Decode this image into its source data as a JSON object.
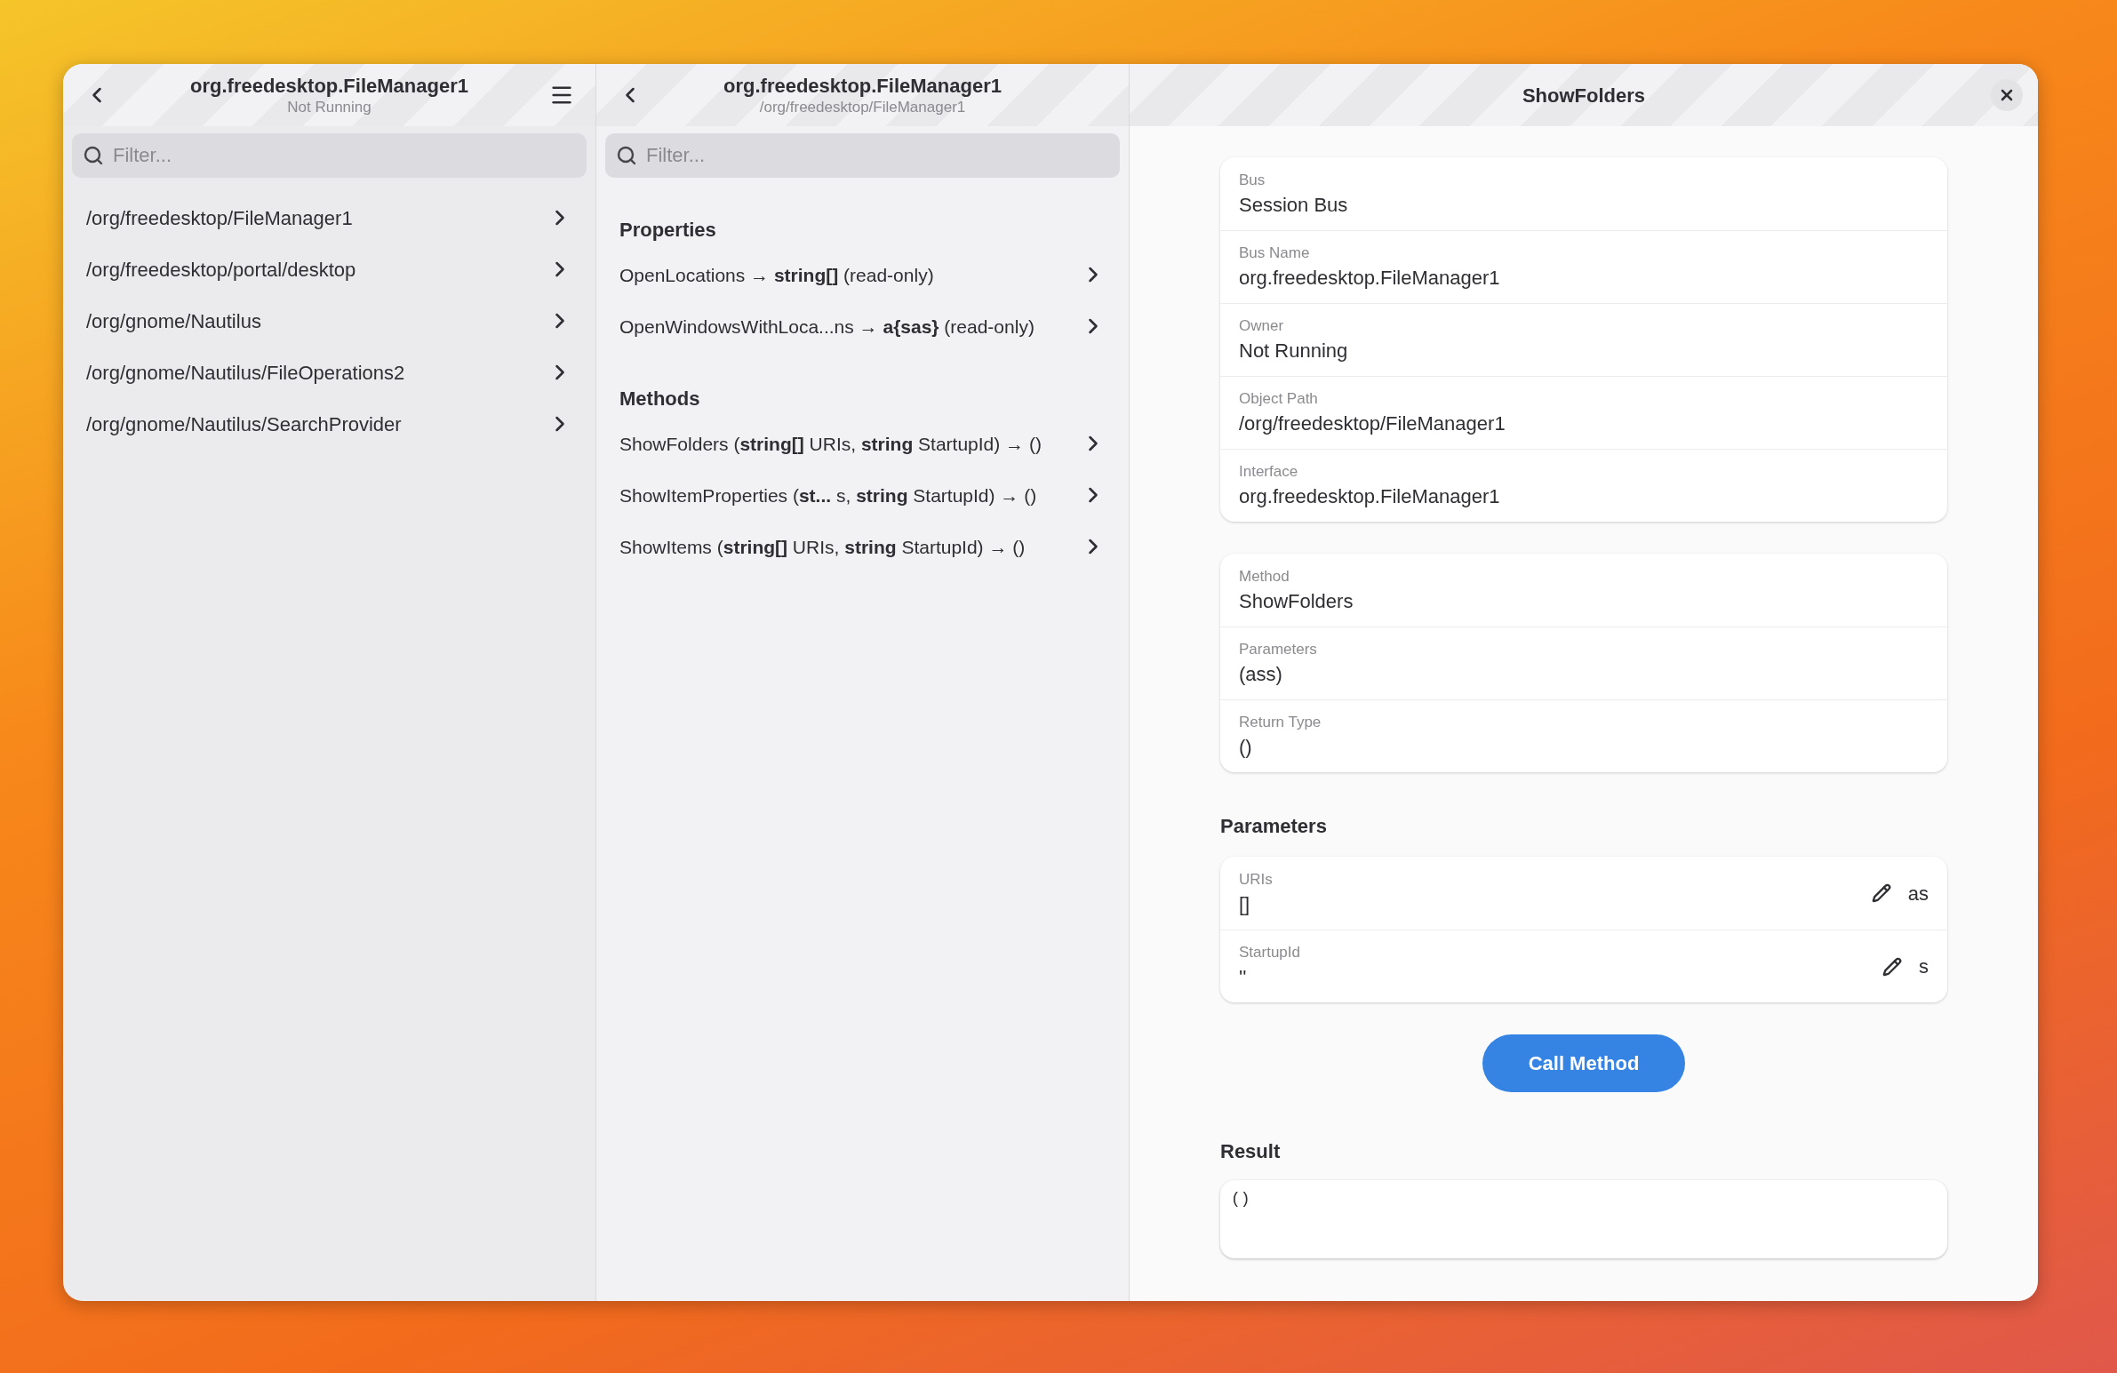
{
  "objects_pane": {
    "title": "org.freedesktop.FileManager1",
    "subtitle": "Not Running",
    "filter": {
      "placeholder": "Filter..."
    },
    "items": [
      {
        "label": "/org/freedesktop/FileManager1"
      },
      {
        "label": "/org/freedesktop/portal/desktop"
      },
      {
        "label": "/org/gnome/Nautilus"
      },
      {
        "label": "/org/gnome/Nautilus/FileOperations2"
      },
      {
        "label": "/org/gnome/Nautilus/SearchProvider"
      }
    ]
  },
  "interface_pane": {
    "title": "org.freedesktop.FileManager1",
    "subtitle": "/org/freedesktop/FileManager1",
    "filter": {
      "placeholder": "Filter..."
    },
    "sections": [
      {
        "heading": "Properties",
        "items": [
          {
            "label": "OpenLocations → **string[]** (read-only)"
          },
          {
            "label": "OpenWindowsWithLoca...ns → **a{sas}** (read-only)"
          }
        ]
      },
      {
        "heading": "Methods",
        "items": [
          {
            "label": "ShowFolders (**string[]** URIs, **string** StartupId) → ()"
          },
          {
            "label": "ShowItemProperties (**st...** s, **string** StartupId) → ()"
          },
          {
            "label": "ShowItems (**string[]** URIs, **string** StartupId) → ()"
          }
        ]
      }
    ]
  },
  "detail_pane": {
    "title": "ShowFolders",
    "info_card": [
      {
        "label": "Bus",
        "value": "Session Bus"
      },
      {
        "label": "Bus Name",
        "value": "org.freedesktop.FileManager1"
      },
      {
        "label": "Owner",
        "value": "Not Running"
      },
      {
        "label": "Object Path",
        "value": "/org/freedesktop/FileManager1"
      },
      {
        "label": "Interface",
        "value": "org.freedesktop.FileManager1"
      }
    ],
    "method_card": [
      {
        "label": "Method",
        "value": "ShowFolders"
      },
      {
        "label": "Parameters",
        "value": "(ass)"
      },
      {
        "label": "Return Type",
        "value": "()"
      }
    ],
    "parameters_heading": "Parameters",
    "parameters": [
      {
        "name": "URIs",
        "value": "[]",
        "type": "as"
      },
      {
        "name": "StartupId",
        "value": "''",
        "type": "s"
      }
    ],
    "call_button": "Call Method",
    "result_heading": "Result",
    "result": "()"
  }
}
